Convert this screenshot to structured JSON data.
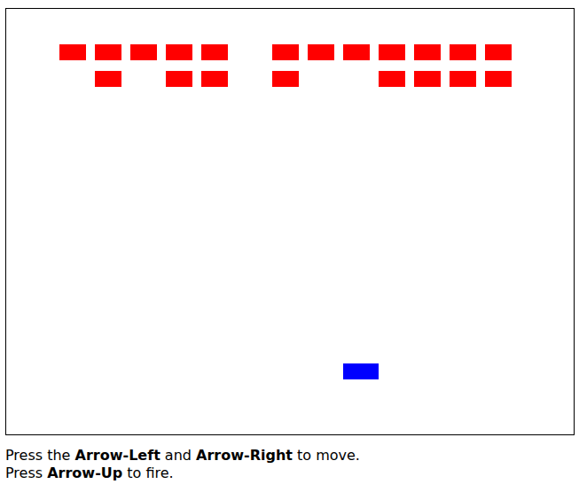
{
  "game": {
    "enemies": [
      [
        {
          "alive": true
        },
        {
          "alive": true
        },
        {
          "alive": true
        },
        {
          "alive": true
        },
        {
          "alive": true
        },
        {
          "alive": false
        },
        {
          "alive": true
        },
        {
          "alive": true
        },
        {
          "alive": true
        },
        {
          "alive": true
        },
        {
          "alive": true
        },
        {
          "alive": true
        },
        {
          "alive": true
        }
      ],
      [
        {
          "alive": false
        },
        {
          "alive": true
        },
        {
          "alive": false
        },
        {
          "alive": true
        },
        {
          "alive": true
        },
        {
          "alive": false
        },
        {
          "alive": true
        },
        {
          "alive": false
        },
        {
          "alive": false
        },
        {
          "alive": true
        },
        {
          "alive": true
        },
        {
          "alive": true
        },
        {
          "alive": true
        }
      ]
    ],
    "player": {
      "column": 8
    }
  },
  "instructions": [
    [
      {
        "text": "Press the ",
        "bold": false
      },
      {
        "text": "Arrow-Left",
        "bold": true
      },
      {
        "text": " and ",
        "bold": false
      },
      {
        "text": "Arrow-Right",
        "bold": true
      },
      {
        "text": " to move.",
        "bold": false
      }
    ],
    [
      {
        "text": "Press ",
        "bold": false
      },
      {
        "text": "Arrow-Up",
        "bold": true
      },
      {
        "text": " to fire.",
        "bold": false
      }
    ]
  ]
}
